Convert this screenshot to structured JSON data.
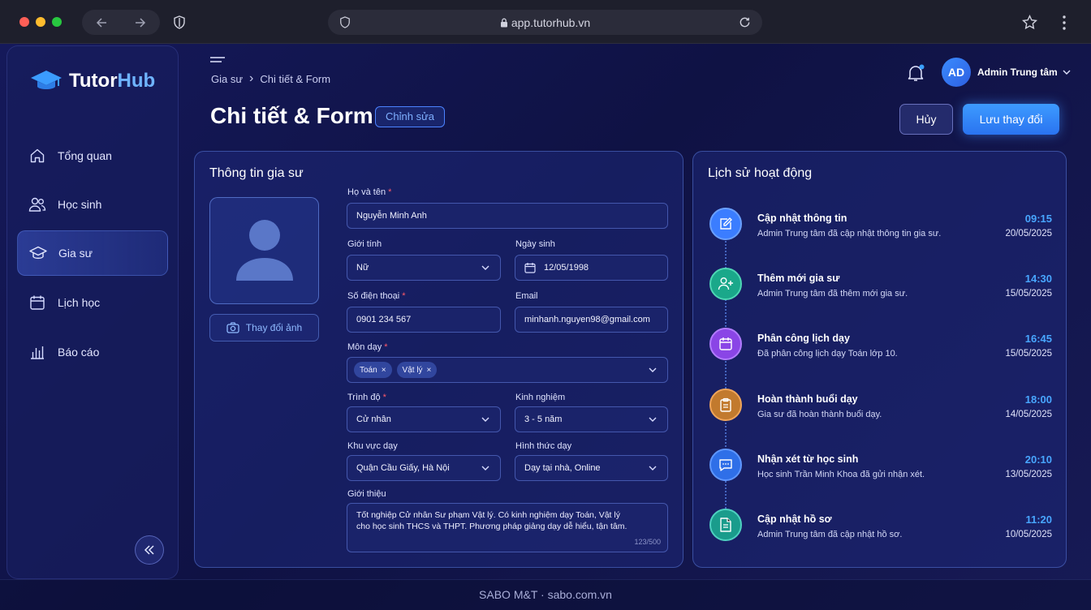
{
  "browser": {
    "url": "app.tutorhub.vn"
  },
  "brand": {
    "name_part1": "Tutor",
    "name_part2": "Hub"
  },
  "sidebar": {
    "items": [
      {
        "label": "Tổng quan",
        "icon": "home-icon"
      },
      {
        "label": "Học sinh",
        "icon": "users-icon"
      },
      {
        "label": "Gia sư",
        "icon": "graduation-cap-icon",
        "active": true
      },
      {
        "label": "Lịch học",
        "icon": "calendar-icon"
      },
      {
        "label": "Báo cáo",
        "icon": "bar-chart-icon"
      }
    ]
  },
  "breadcrumb": {
    "parent": "Gia sư",
    "separator": "›",
    "current": "Chi tiết & Form"
  },
  "header": {
    "title": "Chi tiết & Form",
    "mode_badge": "Chỉnh sửa",
    "cancel_label": "Hủy",
    "save_label": "Lưu thay đổi"
  },
  "user": {
    "initials": "AD",
    "name": "Admin Trung tâm"
  },
  "form": {
    "title": "Thông tin gia sư",
    "change_photo_label": "Thay đổi ảnh",
    "fullname": {
      "label": "Họ và tên",
      "value": "Nguyễn Minh Anh"
    },
    "gender": {
      "label": "Giới tính",
      "value": "Nữ"
    },
    "dob": {
      "label": "Ngày sinh",
      "value": "12/05/1998"
    },
    "phone": {
      "label": "Số điện thoại",
      "value": "0901 234 567"
    },
    "email": {
      "label": "Email",
      "value": "minhanh.nguyen98@gmail.com"
    },
    "subjects": {
      "label": "Môn dạy",
      "values": [
        "Toán",
        "Vật lý"
      ]
    },
    "degree": {
      "label": "Trình độ",
      "value": "Cử nhân"
    },
    "experience": {
      "label": "Kinh nghiệm",
      "value": "3 - 5 năm"
    },
    "area": {
      "label": "Khu vực dạy",
      "value": "Quận Cầu Giấy, Hà Nội"
    },
    "mode": {
      "label": "Hình thức dạy",
      "value": "Dạy tại nhà, Online"
    },
    "intro": {
      "label": "Giới thiệu",
      "value_line1": "Tốt nghiệp Cử nhân Sư phạm Vật lý. Có kinh nghiệm dạy Toán, Vật lý",
      "value_line2": "cho học sinh THCS và THPT. Phương pháp giảng dạy dễ hiểu, tận tâm.",
      "counter": "123/500"
    }
  },
  "activity": {
    "title": "Lịch sử hoạt động",
    "events": [
      {
        "title": "Cập nhật thông tin",
        "desc": "Admin Trung tâm đã cập nhật thông tin gia sư.",
        "time": "09:15",
        "date": "20/05/2025",
        "icon": "edit-icon",
        "color": "#3b7dff"
      },
      {
        "title": "Thêm mới gia sư",
        "desc": "Admin Trung tâm đã thêm mới gia sư.",
        "time": "14:30",
        "date": "15/05/2025",
        "icon": "user-plus-icon",
        "color": "#1aa88a"
      },
      {
        "title": "Phân công lịch dạy",
        "desc": "Đã phân công lịch dạy Toán lớp 10.",
        "time": "16:45",
        "date": "15/05/2025",
        "icon": "calendar-icon",
        "color": "#8a45e6"
      },
      {
        "title": "Hoàn thành buổi dạy",
        "desc": "Gia sư đã hoàn thành buổi dạy.",
        "time": "18:00",
        "date": "14/05/2025",
        "icon": "clipboard-icon",
        "color": "#c27a2e"
      },
      {
        "title": "Nhận xét từ học sinh",
        "desc": "Học sinh Trần Minh Khoa đã gửi nhận xét.",
        "time": "20:10",
        "date": "13/05/2025",
        "icon": "message-icon",
        "color": "#2f6fe8"
      },
      {
        "title": "Cập nhật hồ sơ",
        "desc": "Admin Trung tâm đã cập nhật hồ sơ.",
        "time": "11:20",
        "date": "10/05/2025",
        "icon": "document-icon",
        "color": "#1a9c8c"
      }
    ]
  },
  "footer": {
    "text": "SABO M&T · sabo.com.vn"
  }
}
